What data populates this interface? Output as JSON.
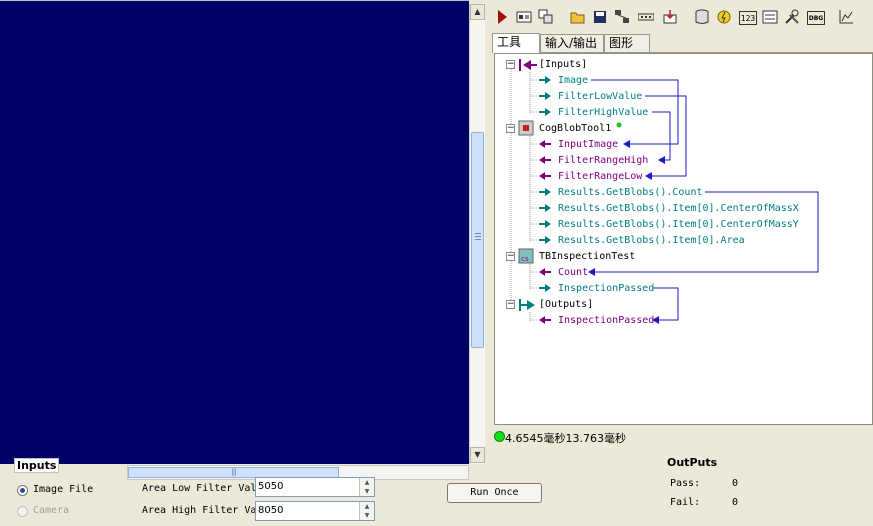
{
  "toolbar": {
    "icons": [
      "run-icon",
      "settings-icon",
      "tool-add-icon",
      "open-folder-icon",
      "save-icon",
      "network-icon",
      "ellipsis-icon",
      "import-icon",
      "database-icon",
      "lightning-icon",
      "counter-icon",
      "form-icon",
      "tools-icon",
      "debug-icon",
      "chart-icon"
    ],
    "counter_label": "123",
    "debug_label": "DBG"
  },
  "tabs": [
    "工具",
    "输入/输出",
    "图形"
  ],
  "tree": {
    "inputs_group": "[Inputs]",
    "inputs": [
      "Image",
      "FilterLowValue",
      "FilterHighValue"
    ],
    "blob_tool": "CogBlobTool1",
    "blob_inputs": [
      "InputImage",
      "FilterRangeHigh",
      "FilterRangeLow"
    ],
    "blob_outputs": [
      "Results.GetBlobs().Count",
      "Results.GetBlobs().Item[0].CenterOfMassX",
      "Results.GetBlobs().Item[0].CenterOfMassY",
      "Results.GetBlobs().Item[0].Area"
    ],
    "script_tool": "TBInspectionTest",
    "script_inputs": [
      "Count"
    ],
    "script_outputs": [
      "InspectionPassed"
    ],
    "outputs_group": "[Outputs]",
    "outputs": [
      "InspectionPassed"
    ]
  },
  "status": {
    "timing": "4.6545毫秒13.763毫秒",
    "color": "#18e018"
  },
  "inputs_panel": {
    "title": "Inputs",
    "image_file": "Image File",
    "camera": "Camera",
    "low_label": "Area Low Filter Val",
    "low_value": "5050",
    "high_label": "Area High Filter Va",
    "high_value": "8050"
  },
  "run_button": "Run Once",
  "outputs_panel": {
    "title": "OutPuts",
    "pass_label": "Pass:",
    "pass_value": "0",
    "fail_label": "Fail:",
    "fail_value": "0"
  },
  "colors": {
    "display_bg": "#000066",
    "input_link": "#007e7e",
    "output_link": "#80007f",
    "wire": "#1a1acc"
  }
}
